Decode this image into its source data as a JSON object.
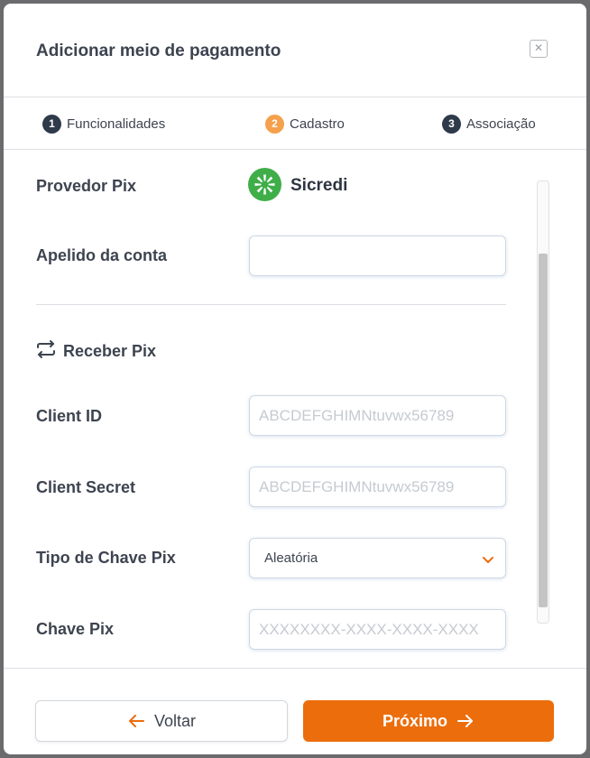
{
  "modal": {
    "title": "Adicionar meio de pagamento",
    "close_glyph": "✕"
  },
  "steps": [
    {
      "number": "1",
      "label": "Funcionalidades",
      "color": "#2f3a4a"
    },
    {
      "number": "2",
      "label": "Cadastro",
      "color": "#f5a04c"
    },
    {
      "number": "3",
      "label": "Associação",
      "color": "#2f3a4a"
    }
  ],
  "form": {
    "provider_label": "Provedor Pix",
    "provider_name": "Sicredi",
    "nickname_label": "Apelido da conta",
    "nickname_value": "",
    "receive_section_title": "Receber Pix",
    "client_id_label": "Client ID",
    "client_id_placeholder": "ABCDEFGHIMNtuvwx56789",
    "client_secret_label": "Client Secret",
    "client_secret_placeholder": "ABCDEFGHIMNtuvwx56789",
    "key_type_label": "Tipo de Chave Pix",
    "key_type_value": "Aleatória",
    "key_label": "Chave Pix",
    "key_placeholder": "XXXXXXXX-XXXX-XXXX-XXXX"
  },
  "footer": {
    "back_label": "Voltar",
    "next_label": "Próximo"
  },
  "colors": {
    "accent": "#ec6d0c",
    "provider_green": "#3fae49",
    "text_dark": "#3d4450"
  },
  "icons": {
    "provider": "sicredi-logo-icon",
    "receive": "swap-arrows-icon",
    "select": "chevron-down-icon",
    "back": "arrow-left-icon",
    "next": "arrow-right-icon",
    "close": "close-icon"
  }
}
